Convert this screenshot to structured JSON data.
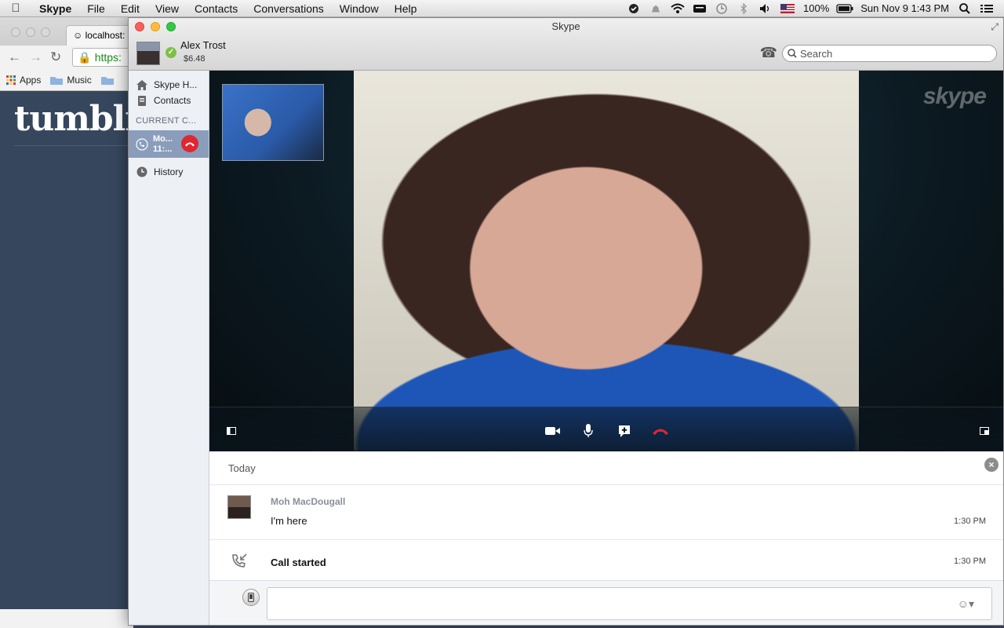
{
  "menubar": {
    "app": "Skype",
    "items": [
      "File",
      "Edit",
      "View",
      "Contacts",
      "Conversations",
      "Window",
      "Help"
    ],
    "battery": "100%",
    "clock": "Sun Nov 9  1:43 PM"
  },
  "browser": {
    "tab_title": "localhost:",
    "url": "https:",
    "bookmarks": [
      "Apps",
      "Music"
    ],
    "site_logo": "tumblr"
  },
  "skype": {
    "window_title": "Skype",
    "profile": {
      "name": "Alex Trost",
      "credit": "$6.48"
    },
    "search": {
      "placeholder": "Search"
    },
    "sidebar": {
      "home": "Skype H...",
      "contacts": "Contacts",
      "section_current": "CURRENT C...",
      "current_call": {
        "name": "Mo...",
        "time": "11:..."
      },
      "history": "History"
    },
    "video": {
      "watermark": "skype"
    },
    "chat": {
      "day": "Today",
      "messages": [
        {
          "author": "Moh MacDougall",
          "text": "I'm here",
          "time": "1:30 PM"
        }
      ],
      "events": [
        {
          "text": "Call started",
          "time": "1:30 PM"
        }
      ]
    }
  }
}
